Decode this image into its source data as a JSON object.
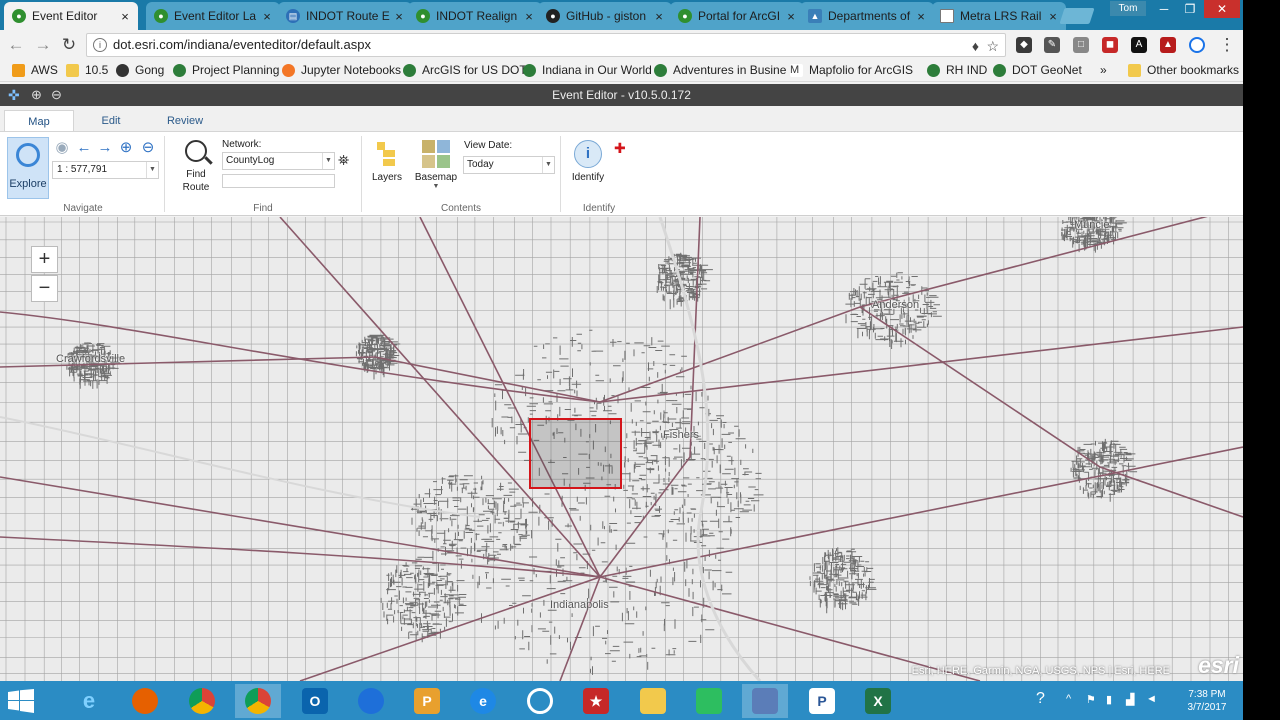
{
  "browser": {
    "tabs": [
      {
        "label": "Event Editor",
        "active": true
      },
      {
        "label": "Event Editor La"
      },
      {
        "label": "INDOT Route E"
      },
      {
        "label": "INDOT Realign"
      },
      {
        "label": "GitHub - giston"
      },
      {
        "label": "Portal for ArcGI"
      },
      {
        "label": "Departments of"
      },
      {
        "label": "Metra LRS Rail"
      }
    ],
    "close_glyph": "×",
    "profile_name": "Tom",
    "window_min": "─",
    "window_max": "❐",
    "window_close": "✕",
    "url": "dot.esri.com/indiana/eventeditor/default.aspx",
    "back_glyph": "←",
    "forward_glyph": "→",
    "reload_glyph": "↻",
    "info_glyph": "i",
    "pin_glyph": "♦",
    "star_glyph": "☆",
    "menu_glyph": "⋮",
    "bookmarks": [
      "AWS",
      "10.5",
      "Gong",
      "Project Planning",
      "Jupyter Notebooks",
      "ArcGIS for US DOT",
      "Indiana in Our World",
      "Adventures in Busine",
      "Mapfolio for ArcGIS",
      "RH IND",
      "DOT GeoNet"
    ],
    "bookmarks_more": "»",
    "other_bookmarks": "Other bookmarks"
  },
  "app": {
    "title": "Event Editor - v10.5.0.172",
    "ribbon_tabs": [
      "Map",
      "Edit",
      "Review"
    ],
    "navigate": {
      "group_label": "Navigate",
      "explore_label": "Explore",
      "scale": "1 : 577,791"
    },
    "find": {
      "group_label": "Find",
      "find_route_label_1": "Find",
      "find_route_label_2": "Route",
      "network_label": "Network:",
      "network_value": "CountyLog",
      "network_text": ""
    },
    "contents": {
      "group_label": "Contents",
      "layers_label": "Layers",
      "basemap_label": "Basemap",
      "view_date_label": "View Date:",
      "view_date_value": "Today"
    },
    "identify": {
      "group_label": "Identify",
      "identify_label": "Identify"
    }
  },
  "map": {
    "zoom_in": "+",
    "zoom_out": "−",
    "cities": [
      "Crawfordsville",
      "Muncie",
      "Anderson",
      "Fishers",
      "Indianapolis"
    ],
    "attribution": "Esri, HERE, Garmin, NGA, USGS, NPS | Esri, HERE",
    "esri_logo": "esri"
  },
  "taskbar": {
    "apps": [
      "Internet Explorer",
      "Firefox",
      "Chrome",
      "Chrome",
      "Outlook",
      "Globe",
      "PowerPoint",
      "IE",
      "Search",
      "Pin",
      "Explorer",
      "Evernote",
      "Network",
      "Publisher",
      "Excel"
    ],
    "time": "7:38 PM",
    "date": "3/7/2017"
  }
}
